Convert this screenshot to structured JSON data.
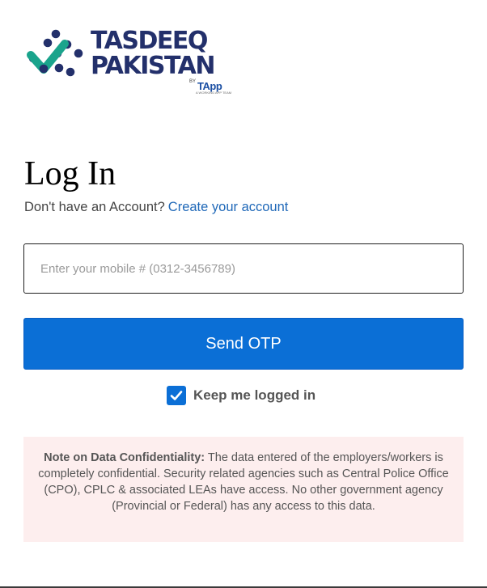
{
  "brand": {
    "name_line1": "TASDEEQ",
    "name_line2": "PAKISTAN",
    "by_text": "BY",
    "partner": "TApp",
    "partner_tagline": "A WORKING APP TEAM",
    "primary_color": "#23306b",
    "accent_color": "#1aa48c"
  },
  "login": {
    "title": "Log In",
    "no_account_text": "Don't have an Account?",
    "create_account_link": "Create your account",
    "mobile_placeholder": "Enter your mobile # (0312-3456789)",
    "mobile_value": "",
    "send_otp_label": "Send OTP",
    "keep_logged_in_label": "Keep me logged in",
    "keep_logged_in_checked": true,
    "button_color": "#0b6fd6",
    "link_color": "#1f68b8"
  },
  "notice": {
    "heading": "Note on Data Confidentiality:",
    "body": "The data entered of the employers/workers is completely confidential. Security related agencies such as Central Police Office (CPO), CPLC & associated LEAs have access. No other government agency (Provincial or Federal) has any access to this data.",
    "background": "#fdeeee"
  }
}
